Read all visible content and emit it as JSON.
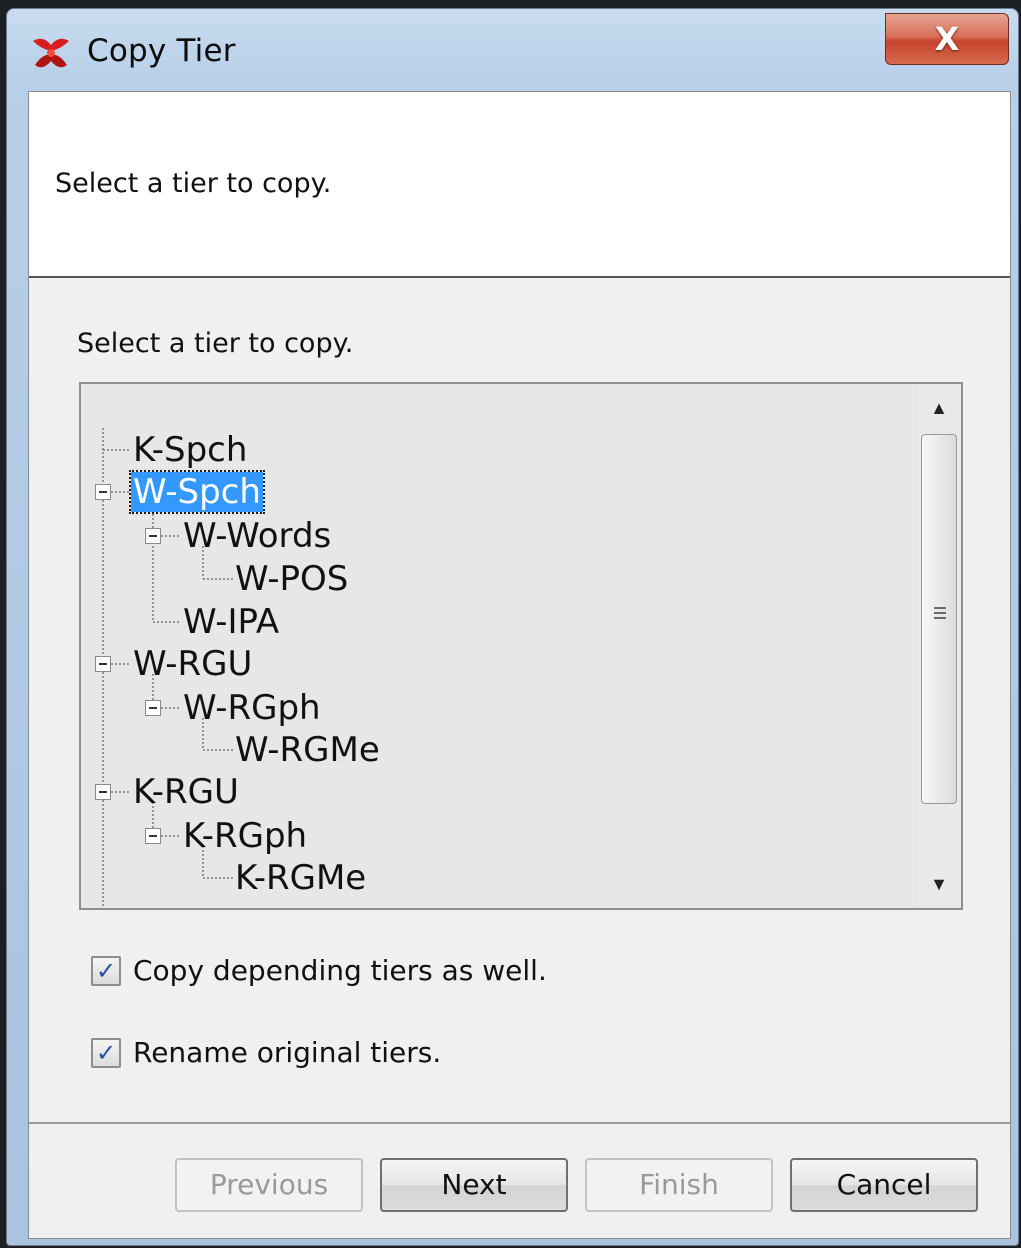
{
  "window": {
    "title": "Copy Tier",
    "close_label": "X",
    "app_icon": "elan-app-icon"
  },
  "header": {
    "text": "Select a tier to copy."
  },
  "panel": {
    "label": "Select a tier to copy."
  },
  "tree": {
    "nodes": [
      {
        "label": "K-Spch",
        "level": 0,
        "expanded": false,
        "selected": false
      },
      {
        "label": "W-Spch",
        "level": 0,
        "expanded": true,
        "selected": true
      },
      {
        "label": "W-Words",
        "level": 1,
        "expanded": true,
        "selected": false
      },
      {
        "label": "W-POS",
        "level": 2,
        "expanded": false,
        "selected": false
      },
      {
        "label": "W-IPA",
        "level": 1,
        "expanded": false,
        "selected": false
      },
      {
        "label": "W-RGU",
        "level": 0,
        "expanded": true,
        "selected": false
      },
      {
        "label": "W-RGph",
        "level": 1,
        "expanded": true,
        "selected": false
      },
      {
        "label": "W-RGMe",
        "level": 2,
        "expanded": false,
        "selected": false
      },
      {
        "label": "K-RGU",
        "level": 0,
        "expanded": true,
        "selected": false
      },
      {
        "label": "K-RGph",
        "level": 1,
        "expanded": true,
        "selected": false
      },
      {
        "label": "K-RGMe",
        "level": 2,
        "expanded": false,
        "selected": false
      }
    ]
  },
  "options": {
    "copy_depending": {
      "label": "Copy depending tiers as well.",
      "checked": true
    },
    "rename_original": {
      "label": "Rename original tiers.",
      "checked": true
    }
  },
  "buttons": {
    "previous": {
      "label": "Previous",
      "enabled": false
    },
    "next": {
      "label": "Next",
      "enabled": true
    },
    "finish": {
      "label": "Finish",
      "enabled": false
    },
    "cancel": {
      "label": "Cancel",
      "enabled": true
    }
  },
  "colors": {
    "selection": "#3399ff",
    "close_button": "#c6432c"
  }
}
